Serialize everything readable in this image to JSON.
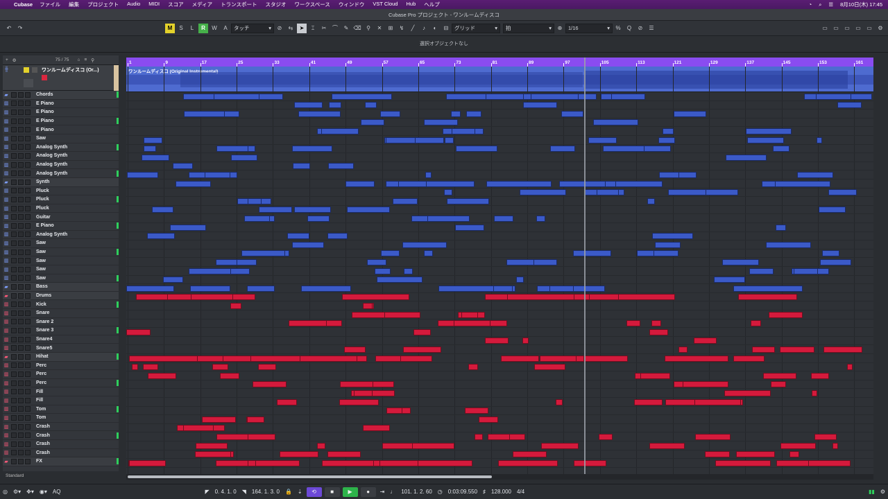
{
  "menubar": {
    "app": "Cubase",
    "items": [
      "ファイル",
      "編集",
      "プロジェクト",
      "Audio",
      "MIDI",
      "スコア",
      "メディア",
      "トランスポート",
      "スタジオ",
      "ワークスペース",
      "ウィンドウ",
      "VST Cloud",
      "Hub",
      "ヘルプ"
    ],
    "clock": "8月10日(木) 17:45"
  },
  "window": {
    "title": "Cubase Pro プロジェクト - ワンルームディスコ"
  },
  "toolbar": {
    "m": "M",
    "s": "S",
    "l": "L",
    "r": "R",
    "w": "W",
    "a": "A",
    "automation_mode": "タッチ",
    "snap_type": "グリッド",
    "grid_label": "拍",
    "quantize": "1/16"
  },
  "infobar": {
    "text": "選択オブジェクトなし"
  },
  "tracklist": {
    "count": "75 / 75",
    "audio_track_name": "ワンルームディスコ (Or...)",
    "footer": "Standard"
  },
  "audio_event": {
    "name": "ワンルームディスコ (Original Instrumental)"
  },
  "ruler": {
    "bars": [
      "1",
      "9",
      "17",
      "25",
      "33",
      "41",
      "49",
      "57",
      "65",
      "73",
      "81",
      "89",
      "97",
      "105",
      "113",
      "121",
      "129",
      "137",
      "145",
      "153",
      "161"
    ]
  },
  "tracks": [
    {
      "name": "Chords",
      "color": "#3b5ac8",
      "folder": true
    },
    {
      "name": "E Piano",
      "color": "#3b5ac8"
    },
    {
      "name": "E Piano",
      "color": "#3b5ac8"
    },
    {
      "name": "E Piano",
      "color": "#3b5ac8"
    },
    {
      "name": "E Piano",
      "color": "#3b5ac8"
    },
    {
      "name": "Saw",
      "color": "#3b5ac8"
    },
    {
      "name": "Analog Synth",
      "color": "#3b5ac8"
    },
    {
      "name": "Analog Synth",
      "color": "#3b5ac8"
    },
    {
      "name": "Analog Synth",
      "color": "#3b5ac8"
    },
    {
      "name": "Analog Synth",
      "color": "#3b5ac8"
    },
    {
      "name": "Synth",
      "color": "#3b5ac8",
      "folder": true
    },
    {
      "name": "Pluck",
      "color": "#3b5ac8"
    },
    {
      "name": "Pluck",
      "color": "#3b5ac8"
    },
    {
      "name": "Pluck",
      "color": "#3b5ac8"
    },
    {
      "name": "Guitar",
      "color": "#3b5ac8"
    },
    {
      "name": "E Piano",
      "color": "#3b5ac8"
    },
    {
      "name": "Analog Synth",
      "color": "#3b5ac8"
    },
    {
      "name": "Saw",
      "color": "#3b5ac8"
    },
    {
      "name": "Saw",
      "color": "#3b5ac8"
    },
    {
      "name": "Saw",
      "color": "#3b5ac8"
    },
    {
      "name": "Saw",
      "color": "#3b5ac8"
    },
    {
      "name": "Saw",
      "color": "#3b5ac8"
    },
    {
      "name": "Bass",
      "color": "#3b5ac8",
      "folder": true
    },
    {
      "name": "Drums",
      "color": "#d41a3c",
      "folder": true
    },
    {
      "name": "Kick",
      "color": "#d41a3c"
    },
    {
      "name": "Snare",
      "color": "#d41a3c"
    },
    {
      "name": "Snare 2",
      "color": "#d41a3c"
    },
    {
      "name": "Snare 3",
      "color": "#d41a3c"
    },
    {
      "name": "Snare4",
      "color": "#d41a3c"
    },
    {
      "name": "Snare5",
      "color": "#d41a3c"
    },
    {
      "name": "Hihat",
      "color": "#d41a3c",
      "folder": true
    },
    {
      "name": "Perc",
      "color": "#d41a3c"
    },
    {
      "name": "Perc",
      "color": "#d41a3c"
    },
    {
      "name": "Perc",
      "color": "#d41a3c"
    },
    {
      "name": "Fill",
      "color": "#d41a3c"
    },
    {
      "name": "Fill",
      "color": "#d41a3c"
    },
    {
      "name": "Tom",
      "color": "#d41a3c"
    },
    {
      "name": "Tom",
      "color": "#d41a3c"
    },
    {
      "name": "Crash",
      "color": "#d41a3c"
    },
    {
      "name": "Crash",
      "color": "#d41a3c"
    },
    {
      "name": "Crash",
      "color": "#d41a3c"
    },
    {
      "name": "Crash",
      "color": "#d41a3c"
    },
    {
      "name": "FX",
      "color": "#d41a3c",
      "folder": true
    }
  ],
  "transport": {
    "left_locator": "0. 4. 1.   0",
    "right_locator": "164. 1. 3.   0",
    "position": "101. 1. 2.  60",
    "time": "0:03:09.550",
    "tempo": "128.000",
    "signature": "4/4",
    "aq": "AQ"
  }
}
